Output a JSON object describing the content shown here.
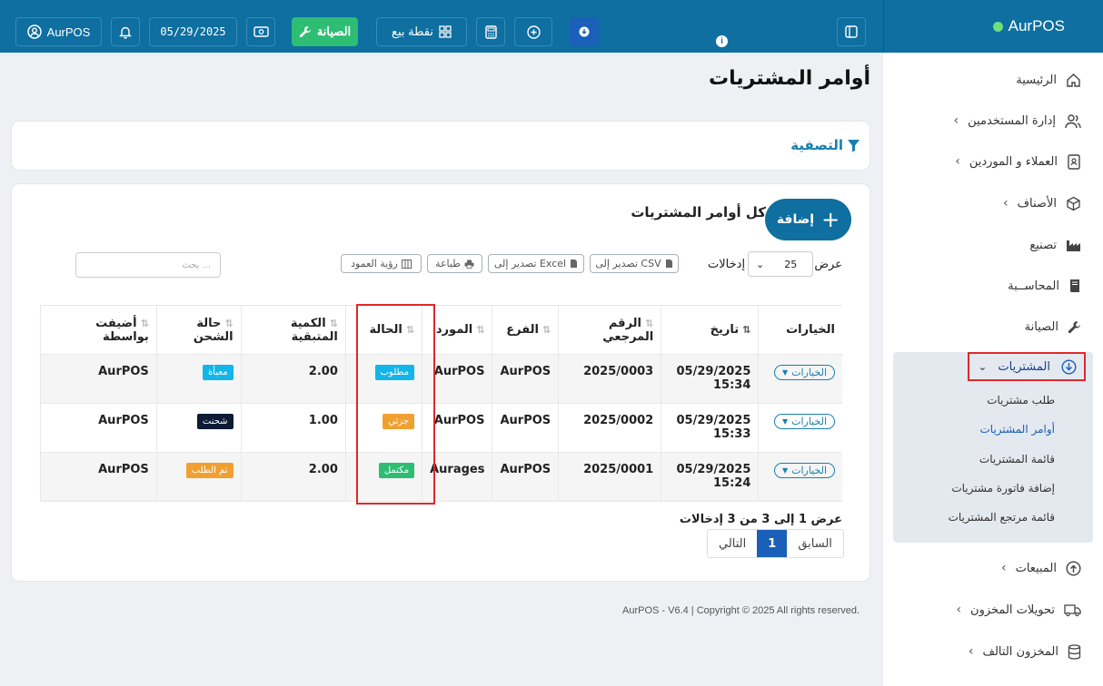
{
  "app": {
    "brand": "AurPOS"
  },
  "topbar": {
    "user": "AurPOS",
    "date": "05/29/2025",
    "maintenance": "الصيانة",
    "pos": "نقطة بيع"
  },
  "sidebar": {
    "items": [
      {
        "label": "الرئيسية",
        "icon": "home-icon"
      },
      {
        "label": "إدارة المستخدمين",
        "icon": "users-icon"
      },
      {
        "label": "العملاء و الموردين",
        "icon": "contacts-icon"
      },
      {
        "label": "الأصناف",
        "icon": "box-icon"
      },
      {
        "label": "تصنيع",
        "icon": "factory-icon"
      },
      {
        "label": "المحاســبة",
        "icon": "book-icon"
      },
      {
        "label": "الصيانة",
        "icon": "wrench-icon"
      },
      {
        "label": "المبيعات",
        "icon": "upload-icon"
      },
      {
        "label": "تحويلات المخزون",
        "icon": "truck-icon"
      },
      {
        "label": "المخزون التالف",
        "icon": "database-icon"
      }
    ],
    "purchases": {
      "label": "المشتريات",
      "children": [
        "طلب مشتريات",
        "أوامر المشتريات",
        "قائمة المشتريات",
        "إضافة فاتورة مشتريات",
        "قائمة مرتجع المشتريات"
      ]
    }
  },
  "page": {
    "title": "أوامر المشتريات",
    "filter_title": "التصفية",
    "card_title": "كل أوامر المشتريات",
    "add_label": "إضافة",
    "show_label": "عرض",
    "entries_value": "25",
    "entries_label": "إدخالات",
    "export_csv": "تصدير إلى CSV",
    "export_excel": "تصدير إلى Excel",
    "print": "طباعة",
    "column_visibility": "رؤية العمود",
    "search_placeholder": "بحث ..."
  },
  "table": {
    "headers": [
      "الخيارات",
      "تاريخ",
      "الرقم المرجعي",
      "الفرع",
      "المورد",
      "الحالة",
      "الكمية المتبقية",
      "حالة الشحن",
      "أضيفت بواسطة"
    ],
    "options_label": "الخيارات",
    "rows": [
      {
        "date": "05/29/2025",
        "time": "15:34",
        "ref": "2025/0003",
        "branch": "AurPOS",
        "supplier": "AurPOS",
        "status": "مطلوب",
        "status_color": "#12b6e8",
        "qty": "2.00",
        "shipping": "معبأة",
        "shipping_color": "#12b6e8",
        "added_by": "AurPOS"
      },
      {
        "date": "05/29/2025",
        "time": "15:33",
        "ref": "2025/0002",
        "branch": "AurPOS",
        "supplier": "AurPOS",
        "status": "جزئي",
        "status_color": "#f0a030",
        "qty": "1.00",
        "shipping": "شحنت",
        "shipping_color": "#0d1b36",
        "added_by": "AurPOS"
      },
      {
        "date": "05/29/2025",
        "time": "15:24",
        "ref": "2025/0001",
        "branch": "AurPOS",
        "supplier": "Aurages",
        "status": "مكتمل",
        "status_color": "#2dbd73",
        "qty": "2.00",
        "shipping": "تم الطلب",
        "shipping_color": "#f0a030",
        "added_by": "AurPOS"
      }
    ]
  },
  "pagination": {
    "info": "عرض 1 إلى 3 من 3 إدخالات",
    "prev": "السابق",
    "current": "1",
    "next": "التالي"
  },
  "footer": {
    "text": "AurPOS - V6.4 | Copyright © 2025 All rights reserved."
  }
}
